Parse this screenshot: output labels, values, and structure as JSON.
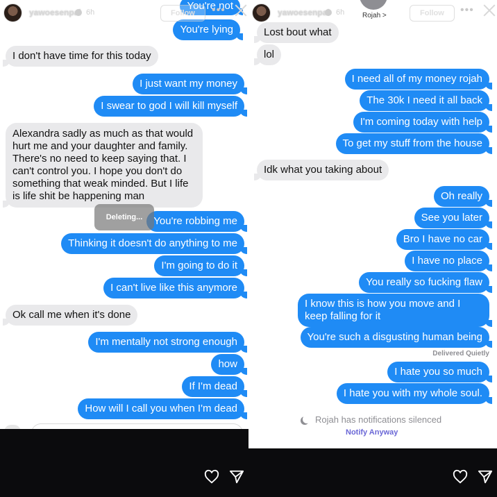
{
  "story": {
    "username": "yawoesenpai",
    "time_ago": "6h",
    "follow_label": "Follow",
    "more_label": "•••"
  },
  "left": {
    "top_partial": "You're not",
    "messages": [
      {
        "dir": "out",
        "text": "You're lying"
      },
      {
        "dir": "in",
        "text": "I don't have time for this today"
      },
      {
        "dir": "out",
        "text": "I just want my money"
      },
      {
        "dir": "out",
        "text": "I swear to god I will kill myself"
      },
      {
        "dir": "in",
        "text": "Alexandra sadly as much as that would hurt me and your daughter and family. There's no need to keep saying that. I can't control you. I hope you don't do something that weak minded. But I life is life shit be happening man"
      },
      {
        "dir": "out",
        "text": "You're robbing me"
      },
      {
        "dir": "out",
        "text": "Thinking it doesn't do anything to me"
      },
      {
        "dir": "out",
        "text": "I'm going to do it"
      },
      {
        "dir": "out",
        "text": "I can't live like this anymore"
      },
      {
        "dir": "in",
        "text": "Ok call me when it's done"
      },
      {
        "dir": "out",
        "text": "I'm mentally not strong enough"
      },
      {
        "dir": "out",
        "text": "how"
      },
      {
        "dir": "out",
        "text": "If I'm dead"
      },
      {
        "dir": "out",
        "text": "How will I call you when I'm dead"
      }
    ],
    "deleting_label": "Deleting..."
  },
  "right": {
    "contact_name": "Rojah >",
    "messages": [
      {
        "dir": "in",
        "text": "Lost bout what"
      },
      {
        "dir": "in",
        "text": "lol"
      },
      {
        "dir": "out",
        "text": "I need all of my money rojah"
      },
      {
        "dir": "out",
        "text": "The 30k I need it all back"
      },
      {
        "dir": "out",
        "text": "I'm coming today with help"
      },
      {
        "dir": "out",
        "text": "To get my stuff from the house"
      },
      {
        "dir": "in",
        "text": "Idk what you taking about"
      },
      {
        "dir": "out",
        "text": "Oh really"
      },
      {
        "dir": "out",
        "text": "See you later"
      },
      {
        "dir": "out",
        "text": "Bro I have no car"
      },
      {
        "dir": "out",
        "text": "I have no place"
      },
      {
        "dir": "out",
        "text": "You really so fucking flaw"
      },
      {
        "dir": "out",
        "text": "I know this is how you move and I keep falling for it"
      },
      {
        "dir": "out",
        "text": "You're such a disgusting human being"
      },
      {
        "dir": "out",
        "text": "I hate you so much"
      },
      {
        "dir": "out",
        "text": "I hate you with my whole soul."
      }
    ],
    "delivered_label": "Delivered Quietly",
    "silenced_label": "Rojah has notifications silenced",
    "notify_label": "Notify Anyway"
  },
  "colors": {
    "outgoing": "#1f8bf5",
    "incoming": "#e9e9eb",
    "notify": "#6a67d6"
  },
  "icons": [
    "heart-icon",
    "send-icon",
    "close-icon",
    "more-icon",
    "moon-icon",
    "verified-icon"
  ]
}
